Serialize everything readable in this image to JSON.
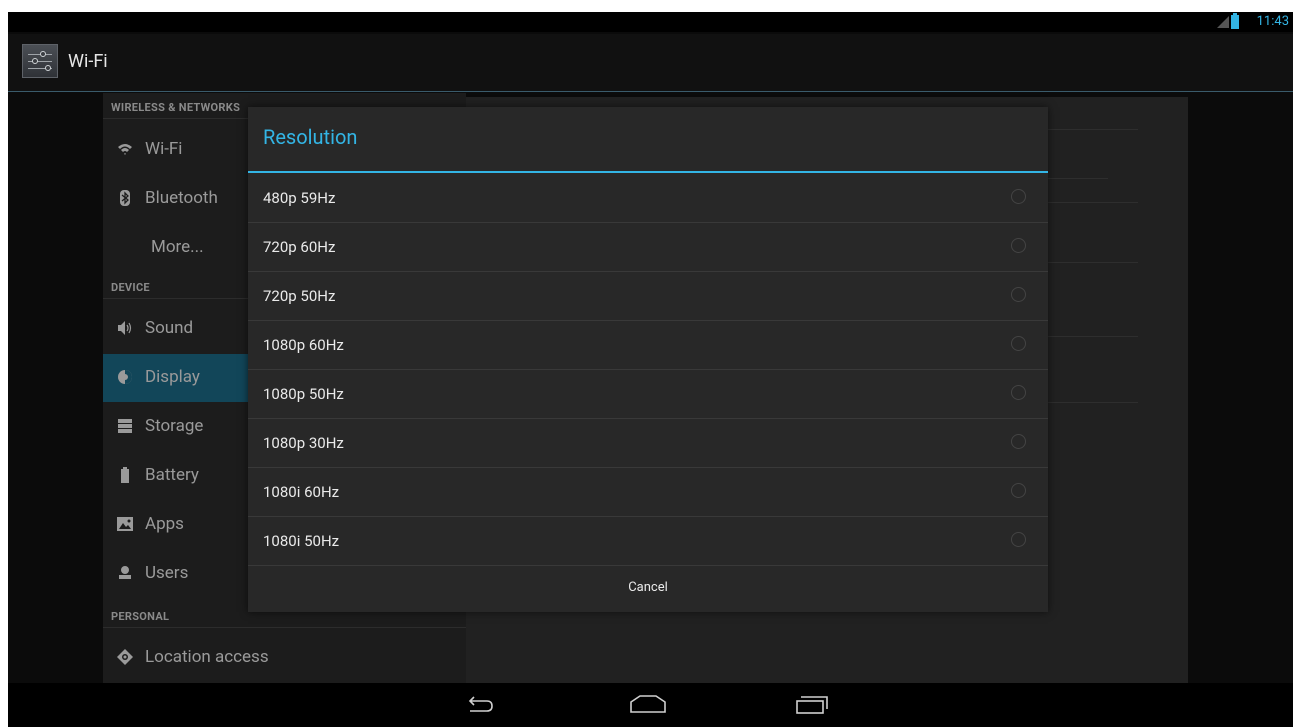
{
  "status_bar": {
    "time": "11:43",
    "signal_icon": "signal-icon",
    "battery_icon": "battery-icon"
  },
  "action_bar": {
    "title": "Wi-Fi",
    "app_icon": "settings-sliders-icon"
  },
  "settings": {
    "sections": [
      {
        "header": "WIRELESS & NETWORKS",
        "items": [
          {
            "label": "Wi-Fi",
            "icon": "wifi-icon"
          },
          {
            "label": "Bluetooth",
            "icon": "bluetooth-icon"
          },
          {
            "label": "More...",
            "icon": ""
          }
        ]
      },
      {
        "header": "DEVICE",
        "items": [
          {
            "label": "Sound",
            "icon": "sound-icon"
          },
          {
            "label": "Display",
            "icon": "display-icon",
            "active": true
          },
          {
            "label": "Storage",
            "icon": "storage-icon"
          },
          {
            "label": "Battery",
            "icon": "battery-icon"
          },
          {
            "label": "Apps",
            "icon": "apps-icon"
          },
          {
            "label": "Users",
            "icon": "users-icon"
          }
        ]
      },
      {
        "header": "PERSONAL",
        "items": [
          {
            "label": "Location access",
            "icon": "location-icon"
          }
        ]
      }
    ]
  },
  "dialog": {
    "title": "Resolution",
    "options": [
      {
        "label": "480p 59Hz",
        "selected": false
      },
      {
        "label": "720p 60Hz",
        "selected": false
      },
      {
        "label": "720p 50Hz",
        "selected": false
      },
      {
        "label": "1080p 60Hz",
        "selected": false
      },
      {
        "label": "1080p 50Hz",
        "selected": false
      },
      {
        "label": "1080p 30Hz",
        "selected": false
      },
      {
        "label": "1080i 60Hz",
        "selected": false
      },
      {
        "label": "1080i 50Hz",
        "selected": false
      }
    ],
    "cancel_label": "Cancel"
  },
  "nav_bar": {
    "back_icon": "back-icon",
    "home_icon": "home-icon",
    "recents_icon": "recent-apps-icon"
  },
  "colors": {
    "accent": "#33b5e5",
    "selected_item_bg": "#124659",
    "dialog_bg": "#282828",
    "screen_bg": "#0b0b0b"
  }
}
